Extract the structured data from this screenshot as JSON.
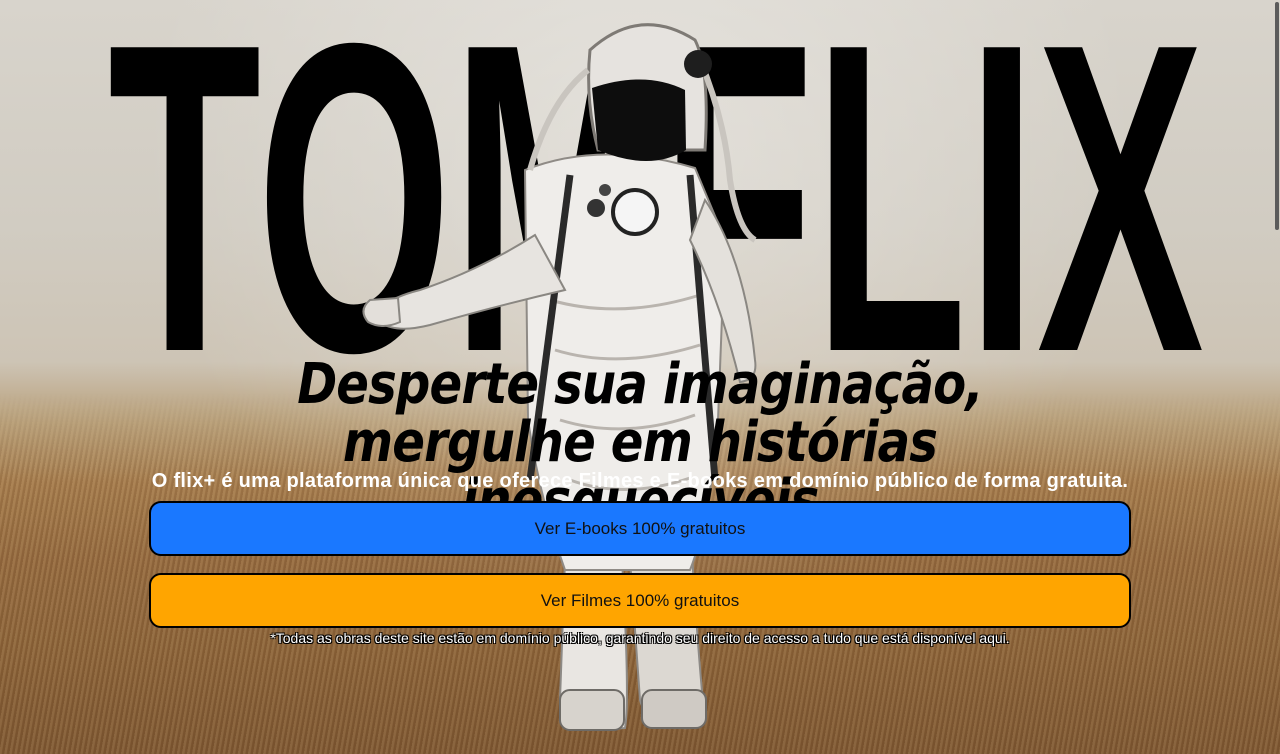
{
  "brand": {
    "wordmark": "TOMFLIX"
  },
  "hero": {
    "headline": "Desperte sua imaginação, mergulhe em histórias inesquecíveis",
    "description": "O flix+ é uma plataforma única que oferece Filmes e E-books em domínio público de forma gratuita."
  },
  "actions": {
    "ebooks_label": "Ver E-books 100% gratuitos",
    "films_label": "Ver Filmes 100% gratuitos"
  },
  "footer": {
    "note": "*Todas as obras deste site estão em domínio público, garantindo seu direito de acesso a tudo que está disponível aqui."
  },
  "colors": {
    "ebooks_button": "#1a78ff",
    "films_button": "#ffa500",
    "wordmark": "#000000"
  },
  "icons": {
    "hero_image": "astronaut-illustration"
  }
}
